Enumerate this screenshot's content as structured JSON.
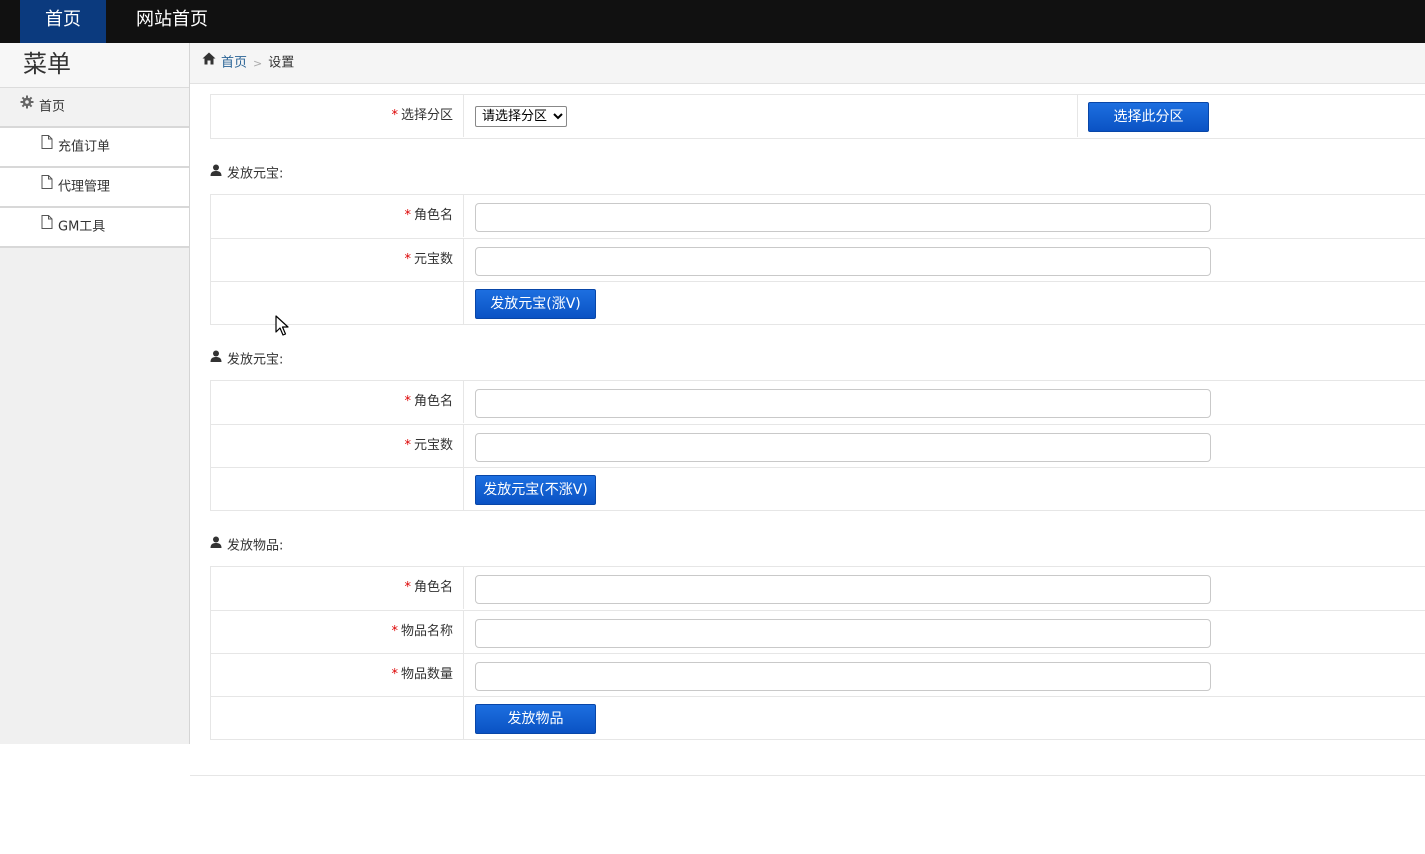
{
  "topnav": {
    "items": [
      {
        "label": "首页",
        "active": true
      },
      {
        "label": "网站首页",
        "active": false
      }
    ]
  },
  "sidebar": {
    "title": "菜单",
    "head": {
      "label": "首页",
      "icon": "gear-icon"
    },
    "items": [
      {
        "label": "充值订单",
        "icon": "file-icon"
      },
      {
        "label": "代理管理",
        "icon": "file-icon"
      },
      {
        "label": "GM工具",
        "icon": "file-icon"
      }
    ]
  },
  "breadcrumb": {
    "home": "首页",
    "current": "设置"
  },
  "zone": {
    "label": "选择分区",
    "select_value": "请选择分区",
    "button": "选择此分区"
  },
  "section1": {
    "title": "发放元宝:",
    "role_label": "角色名",
    "amount_label": "元宝数",
    "button": "发放元宝(涨V)"
  },
  "section2": {
    "title": "发放元宝:",
    "role_label": "角色名",
    "amount_label": "元宝数",
    "button": "发放元宝(不涨V)"
  },
  "section3": {
    "title": "发放物品:",
    "role_label": "角色名",
    "item_name_label": "物品名称",
    "item_count_label": "物品数量",
    "button": "发放物品"
  },
  "colors": {
    "topbar": "#111111",
    "nav_active": "#0b3a7e",
    "button": "#0a52c4",
    "required": "#dd0000"
  }
}
